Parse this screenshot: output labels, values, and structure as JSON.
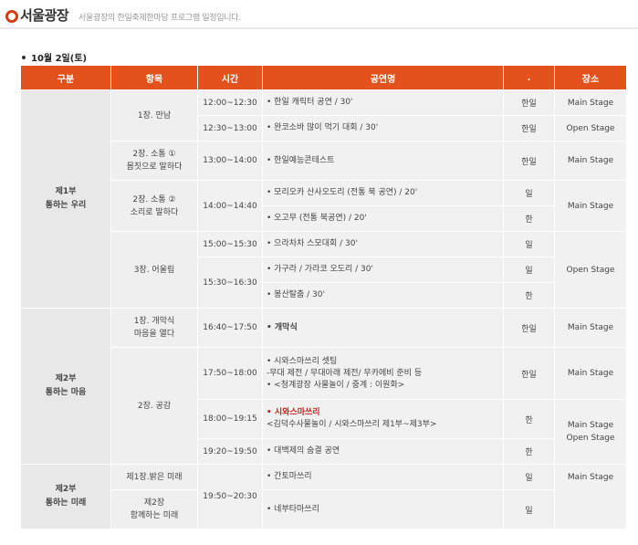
{
  "header": {
    "title": "서울광장",
    "subtitle": "서울광장의 한일축제한마당 프로그램 일정입니다."
  },
  "date": "10월 2일(토)",
  "columns": [
    "구분",
    "항목",
    "시간",
    "공연명",
    ".",
    "장소"
  ],
  "part1": {
    "label1": "제1부",
    "label2": "통하는 우리"
  },
  "part2": {
    "label1": "제2부",
    "label2": "통하는 마음"
  },
  "part3": {
    "label1": "제2부",
    "label2": "통하는 미래"
  },
  "items": {
    "i1": "1장. 만남",
    "i2a": "2장. 소통 ①",
    "i2b": "몸짓으로 말하다",
    "i3a": "2장. 소통 ②",
    "i3b": "소리로 말하다",
    "i4": "3장. 어울림",
    "i5a": "1장. 개막식",
    "i5b": "마음을 열다",
    "i6": "2장. 공감",
    "i7": "제1장.밝은 미래",
    "i8a": "제2장",
    "i8b": "함께하는 미래"
  },
  "times": {
    "t1": "12:00~12:30",
    "t2": "12:30~13:00",
    "t3": "13:00~14:00",
    "t4": "14:00~14:40",
    "t5": "15:00~15:30",
    "t6": "15:30~16:30",
    "t7": "16:40~17:50",
    "t8": "17:50~18:00",
    "t9": "18:00~19:15",
    "t10": "19:20~19:50",
    "t11": "19:50~20:30"
  },
  "perf": {
    "p1": "• 한일 캐릭터 공연 / 30'",
    "p2": "• 완코소바 많이 먹기 대회 / 30'",
    "p3": "• 한일예능콘테스트",
    "p4": "• 모리오카 산사오도리 (전통 북 공연) / 20'",
    "p5": "• 오고무 (전통 북공연) / 20'",
    "p6": "• 으라차차 스모대회 / 30'",
    "p7": "• 가구라 / 가라코 오도리 / 30'",
    "p8": "• 봉산탈춤 / 30'",
    "p9": "• 개막식",
    "p10a": "• 시와스마쓰리 셋팅",
    "p10b": "-무대 제전 / 무대아래 제전/ 무카에비 준비 등",
    "p10c": "• <청계광장 사물놀이 / 중계 : 이원화>",
    "p11a": "• 시와스마쓰리",
    "p11b": "<김덕수사물놀이 / 시와스마쓰리 제1부~제3부>",
    "p12": "• 대백제의 숨결 공연",
    "p13": "• 간토마쓰리",
    "p14": "• 네부타마쓰리"
  },
  "lang": {
    "l1": "한일",
    "l2": "한일",
    "l3": "한일",
    "l4": "일",
    "l5": "한",
    "l6": "일",
    "l7": "일",
    "l8": "한",
    "l9": "한일",
    "l10": "한일",
    "l11": "한",
    "l12": "한",
    "l13": "일",
    "l14": "일"
  },
  "stage": {
    "s1": "Main Stage",
    "s2": "Open Stage",
    "s3": "Main Stage",
    "s4": "Main Stage",
    "s5": "Open Stage",
    "s6": "Main Stage",
    "s7": "Main Stage",
    "s8a": "Main Stage",
    "s8b": "Open Stage",
    "s9": "Main Stage"
  }
}
